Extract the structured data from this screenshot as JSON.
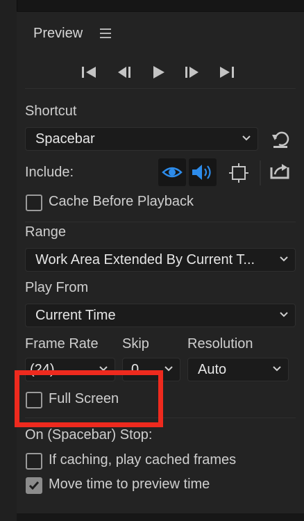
{
  "panel": {
    "title": "Preview"
  },
  "shortcut": {
    "label": "Shortcut",
    "value": "Spacebar"
  },
  "include": {
    "label": "Include:"
  },
  "cache_before_playback": {
    "label": "Cache Before Playback",
    "checked": false
  },
  "range": {
    "label": "Range",
    "value": "Work Area Extended By Current T..."
  },
  "play_from": {
    "label": "Play From",
    "value": "Current Time"
  },
  "frame_rate": {
    "label": "Frame Rate",
    "value": "(24)"
  },
  "skip": {
    "label": "Skip",
    "value": "0"
  },
  "resolution": {
    "label": "Resolution",
    "value": "Auto"
  },
  "full_screen": {
    "label": "Full Screen",
    "checked": false
  },
  "stop": {
    "label": "On (Spacebar) Stop:",
    "if_caching": {
      "label": "If caching, play cached frames",
      "checked": false
    },
    "move_time": {
      "label": "Move time to preview time",
      "checked": true
    }
  },
  "colors": {
    "accent_blue": "#2d8ceb",
    "highlight_red": "#ee2a1e",
    "panel_bg": "#232323"
  }
}
